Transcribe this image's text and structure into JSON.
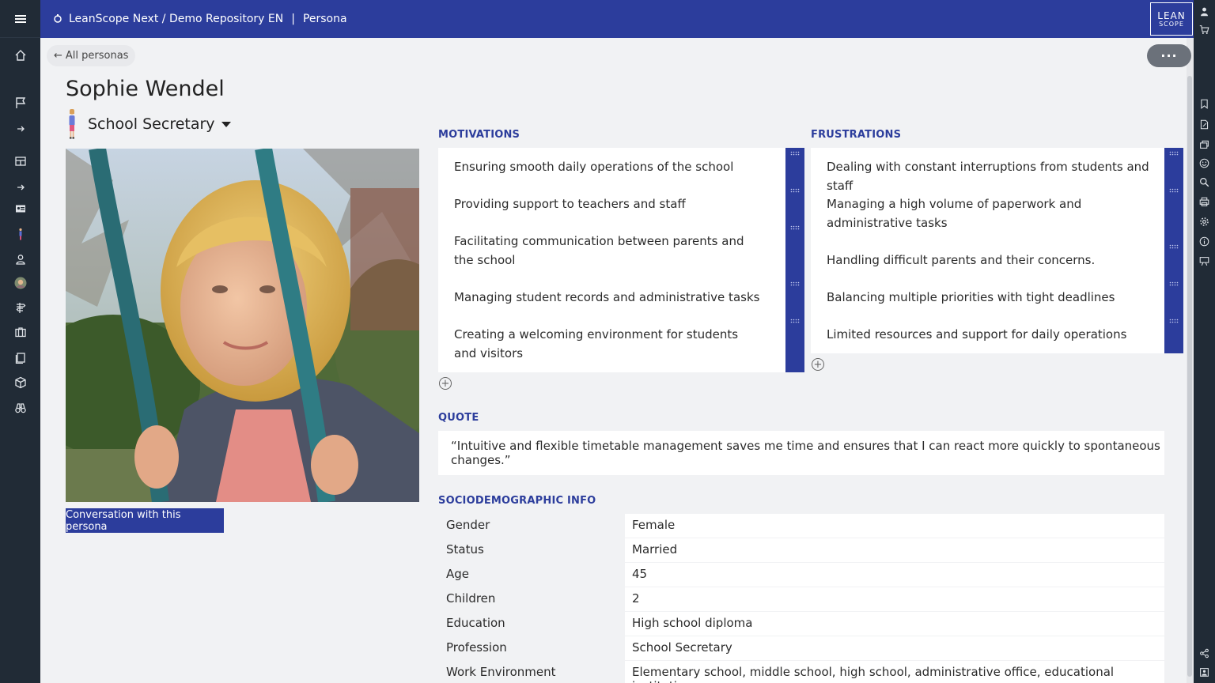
{
  "header": {
    "breadcrumb": "LeanScope Next / Demo Repository EN",
    "section": "Persona",
    "logo_line1": "LEAN",
    "logo_line2": "SCOPE"
  },
  "nav": {
    "back_label": "All personas",
    "more_label": "···"
  },
  "persona": {
    "name": "Sophie Wendel",
    "role": "School Secretary",
    "conversation_button": "Conversation with this persona"
  },
  "motivations": {
    "title": "MOTIVATIONS",
    "items": [
      "Ensuring smooth daily operations of the school",
      "Providing support to teachers and staff",
      "Facilitating communication between parents and the school",
      "Managing student records and administrative tasks",
      "Creating a welcoming environment for students and visitors"
    ]
  },
  "frustrations": {
    "title": "FRUSTRATIONS",
    "items": [
      "Dealing with constant interruptions from students and staff",
      "Managing a high volume of paperwork and administrative tasks",
      "Handling difficult parents and their concerns.",
      "Balancing multiple priorities with tight deadlines",
      "Limited resources and support for daily operations"
    ]
  },
  "quote": {
    "title": "QUOTE",
    "text": "“Intuitive and flexible timetable management saves me time and ensures that I can react more quickly to spontaneous changes.”"
  },
  "socio": {
    "title": "SOCIODEMOGRAPHIC INFO",
    "rows": [
      {
        "key": "Gender",
        "value": "Female"
      },
      {
        "key": "Status",
        "value": "Married"
      },
      {
        "key": "Age",
        "value": "45"
      },
      {
        "key": "Children",
        "value": "2"
      },
      {
        "key": "Education",
        "value": "High school diploma"
      },
      {
        "key": "Profession",
        "value": "School Secretary"
      },
      {
        "key": "Work Environment",
        "value": "Elementary school, middle school, high school, administrative office, educational institution"
      }
    ]
  },
  "colors": {
    "header": "#2c3d9c",
    "sidebar": "#212b36",
    "accent": "#2c3d9c",
    "background": "#f1f2f4"
  }
}
